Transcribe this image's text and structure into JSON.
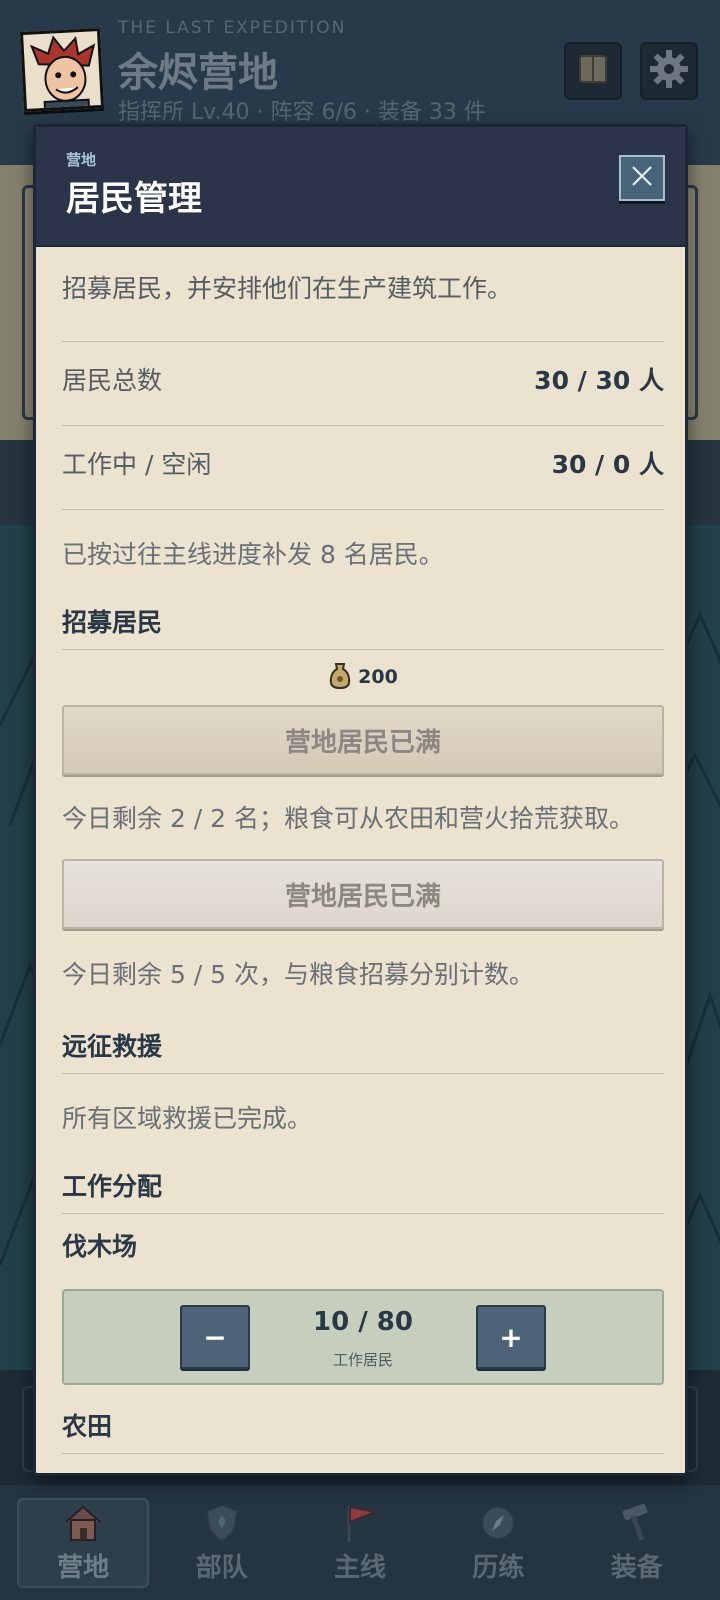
{
  "header": {
    "subtitle": "THE LAST EXPEDITION",
    "camp_name": "余烬营地",
    "stats": "指挥所 Lv.40 · 阵容 6/6 · 装备 33 件"
  },
  "modal": {
    "overline": "营地",
    "title": "居民管理",
    "intro": "招募居民，并安排他们在生产建筑工作。",
    "stats": [
      {
        "label": "居民总数",
        "value": "30 / 30 人"
      },
      {
        "label": "工作中 / 空闲",
        "value": "30 / 0 人"
      }
    ],
    "backfill_note": "已按过往主线进度补发 8 名居民。",
    "recruit": {
      "heading": "招募居民",
      "cost_icon": "food-sack-icon",
      "cost": "200",
      "food_button": "营地居民已满",
      "food_note": "今日剩余 2 / 2 名；粮食可从农田和营火拾荒获取。",
      "alt_button": "营地居民已满",
      "alt_note": "今日剩余 5 / 5 次，与粮食招募分别计数。"
    },
    "rescue": {
      "heading": "远征救援",
      "note": "所有区域救援已完成。"
    },
    "assignment": {
      "heading": "工作分配",
      "buildings": [
        {
          "name": "伐木场",
          "count": "10 / 80",
          "label": "工作居民",
          "minus": "−",
          "plus": "+"
        },
        {
          "name": "农田"
        }
      ]
    }
  },
  "nav": {
    "items": [
      {
        "label": "营地",
        "icon": "house-icon",
        "active": true
      },
      {
        "label": "部队",
        "icon": "shield-icon",
        "active": false
      },
      {
        "label": "主线",
        "icon": "flag-icon",
        "active": false
      },
      {
        "label": "历练",
        "icon": "compass-icon",
        "active": false
      },
      {
        "label": "装备",
        "icon": "hammer-icon",
        "active": false
      }
    ]
  },
  "colors": {
    "panel": "#ebe2d0",
    "header": "#2b3448",
    "accent": "#4d6377",
    "text_dark": "#2a3846"
  }
}
